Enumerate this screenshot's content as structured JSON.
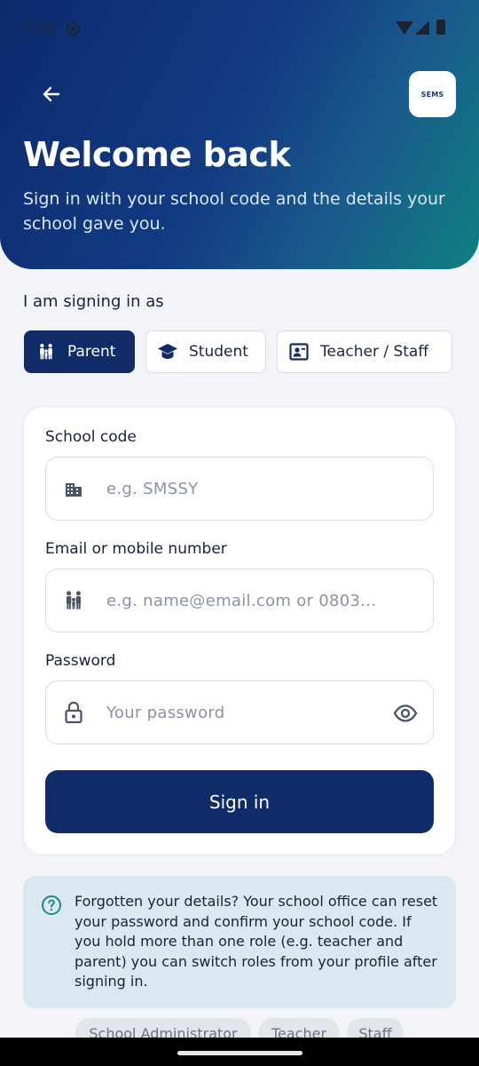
{
  "status_bar": {
    "time": "3:58"
  },
  "header": {
    "back_icon": "arrow-left-icon",
    "logo_text": "SEMS",
    "title": "Welcome back",
    "subtitle": "Sign in with your school code and the details your school gave you."
  },
  "role_selector": {
    "label": "I am signing in as",
    "selected": "Parent",
    "options": [
      {
        "label": "Parent",
        "icon": "family-icon"
      },
      {
        "label": "Student",
        "icon": "graduation-cap-icon"
      },
      {
        "label": "Teacher / Staff",
        "icon": "teacher-badge-icon"
      }
    ]
  },
  "form": {
    "school_code": {
      "label": "School code",
      "placeholder": "e.g. SMSSY",
      "value": "",
      "icon": "building-icon"
    },
    "identifier": {
      "label": "Email or mobile number",
      "placeholder": "e.g. name@email.com or 0803...",
      "value": "",
      "icon": "family-icon"
    },
    "password": {
      "label": "Password",
      "placeholder": "Your password",
      "value": "",
      "icon": "lock-icon",
      "toggle_icon": "eye-icon"
    },
    "submit_label": "Sign in"
  },
  "help": {
    "icon": "help-circle-icon",
    "text": "Forgotten your details? Your school office can reset your password and confirm your school code. If you hold more than one role (e.g. teacher and parent) you can switch roles from your profile after signing in."
  },
  "role_chips": [
    "School Administrator",
    "Teacher",
    "Staff"
  ],
  "colors": {
    "primary": "#0f2c69",
    "header_gradient_start": "#0d2a6e",
    "header_gradient_end": "#0f8080",
    "background": "#f2f4f8",
    "help_background": "#dce8ef",
    "help_icon": "#1a8a90"
  }
}
